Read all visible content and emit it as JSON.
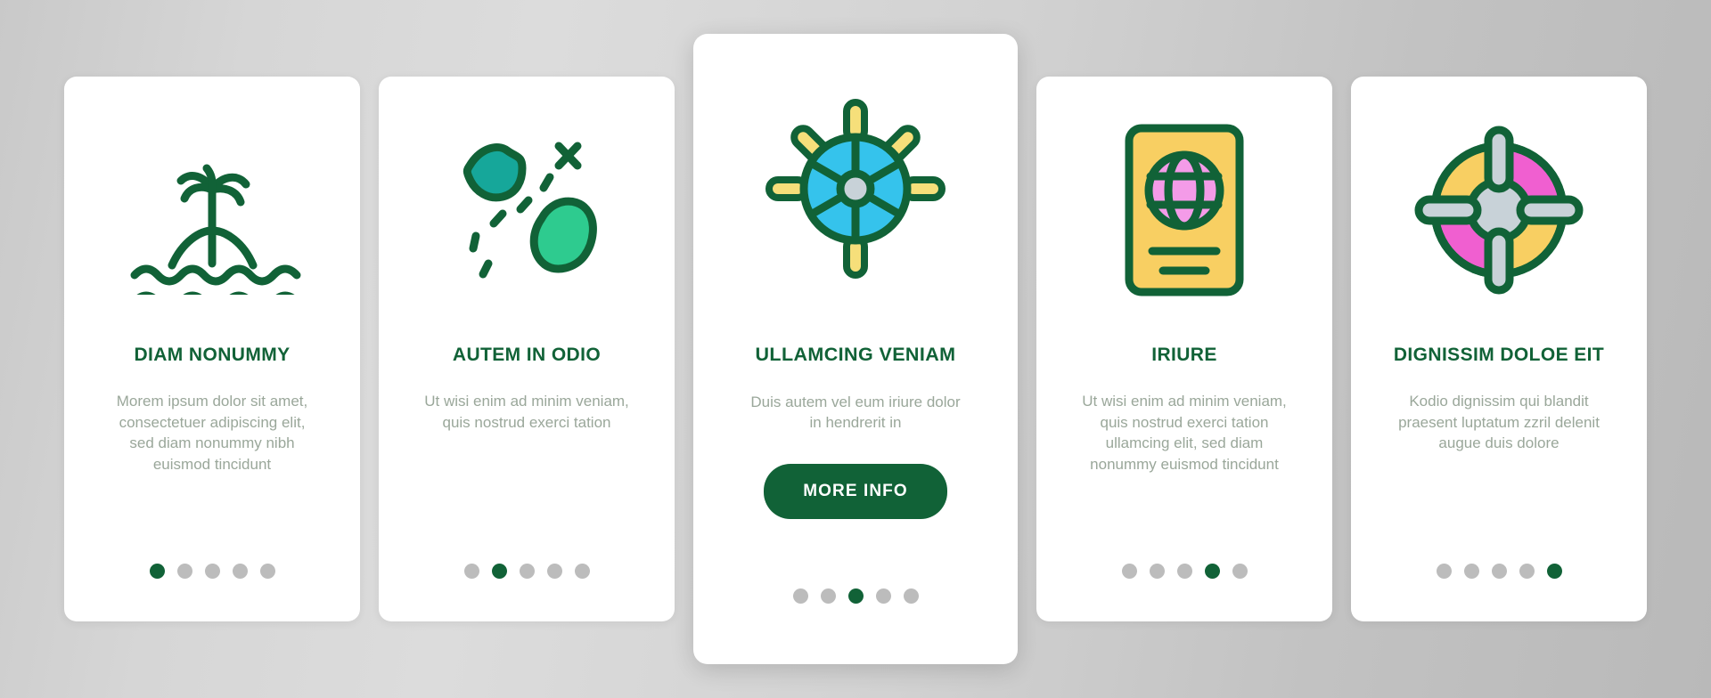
{
  "background": {
    "color_left": "#c9c9c9",
    "color_right": "#b9b9b9"
  },
  "theme": {
    "accent_green": "#116237",
    "body_text": "#9aa79a",
    "dot_inactive": "#bcbcbc",
    "card_background": "#ffffff",
    "icon_cyan": "#35c3ec",
    "icon_teal": "#16a79a",
    "icon_mint": "#2ecb8f",
    "icon_yellow": "#f8cf62",
    "icon_pink": "#f05fd0",
    "icon_gray": "#c8d2d8"
  },
  "cards": [
    {
      "icon_name": "island-palm-tree-icon",
      "title": "DIAM NONUMMY",
      "body": "Morem ipsum dolor sit amet, consectetuer adipiscing elit, sed diam nonummy nibh euismod tincidunt",
      "featured": false,
      "dots": {
        "count": 5,
        "active_index": 0
      },
      "button": null
    },
    {
      "icon_name": "treasure-map-icon",
      "title": "AUTEM IN ODIO",
      "body": "Ut wisi enim ad minim veniam, quis nostrud exerci tation",
      "featured": false,
      "dots": {
        "count": 5,
        "active_index": 1
      },
      "button": null
    },
    {
      "icon_name": "ship-wheel-icon",
      "title": "ULLAMCING VENIAM",
      "body": "Duis autem vel eum iriure dolor in hendrerit in",
      "featured": true,
      "dots": {
        "count": 5,
        "active_index": 2
      },
      "button": {
        "label": "MORE INFO"
      }
    },
    {
      "icon_name": "passport-icon",
      "title": "IRIURE",
      "body": "Ut wisi enim ad minim veniam, quis nostrud exerci tation ullamcing elit, sed diam nonummy euismod tincidunt",
      "featured": false,
      "dots": {
        "count": 5,
        "active_index": 3
      },
      "button": null
    },
    {
      "icon_name": "lifebuoy-icon",
      "title": "DIGNISSIM DOLOE EIT",
      "body": "Kodio dignissim qui blandit praesent luptatum zzril delenit augue duis dolore",
      "featured": false,
      "dots": {
        "count": 5,
        "active_index": 4
      },
      "button": null
    }
  ]
}
